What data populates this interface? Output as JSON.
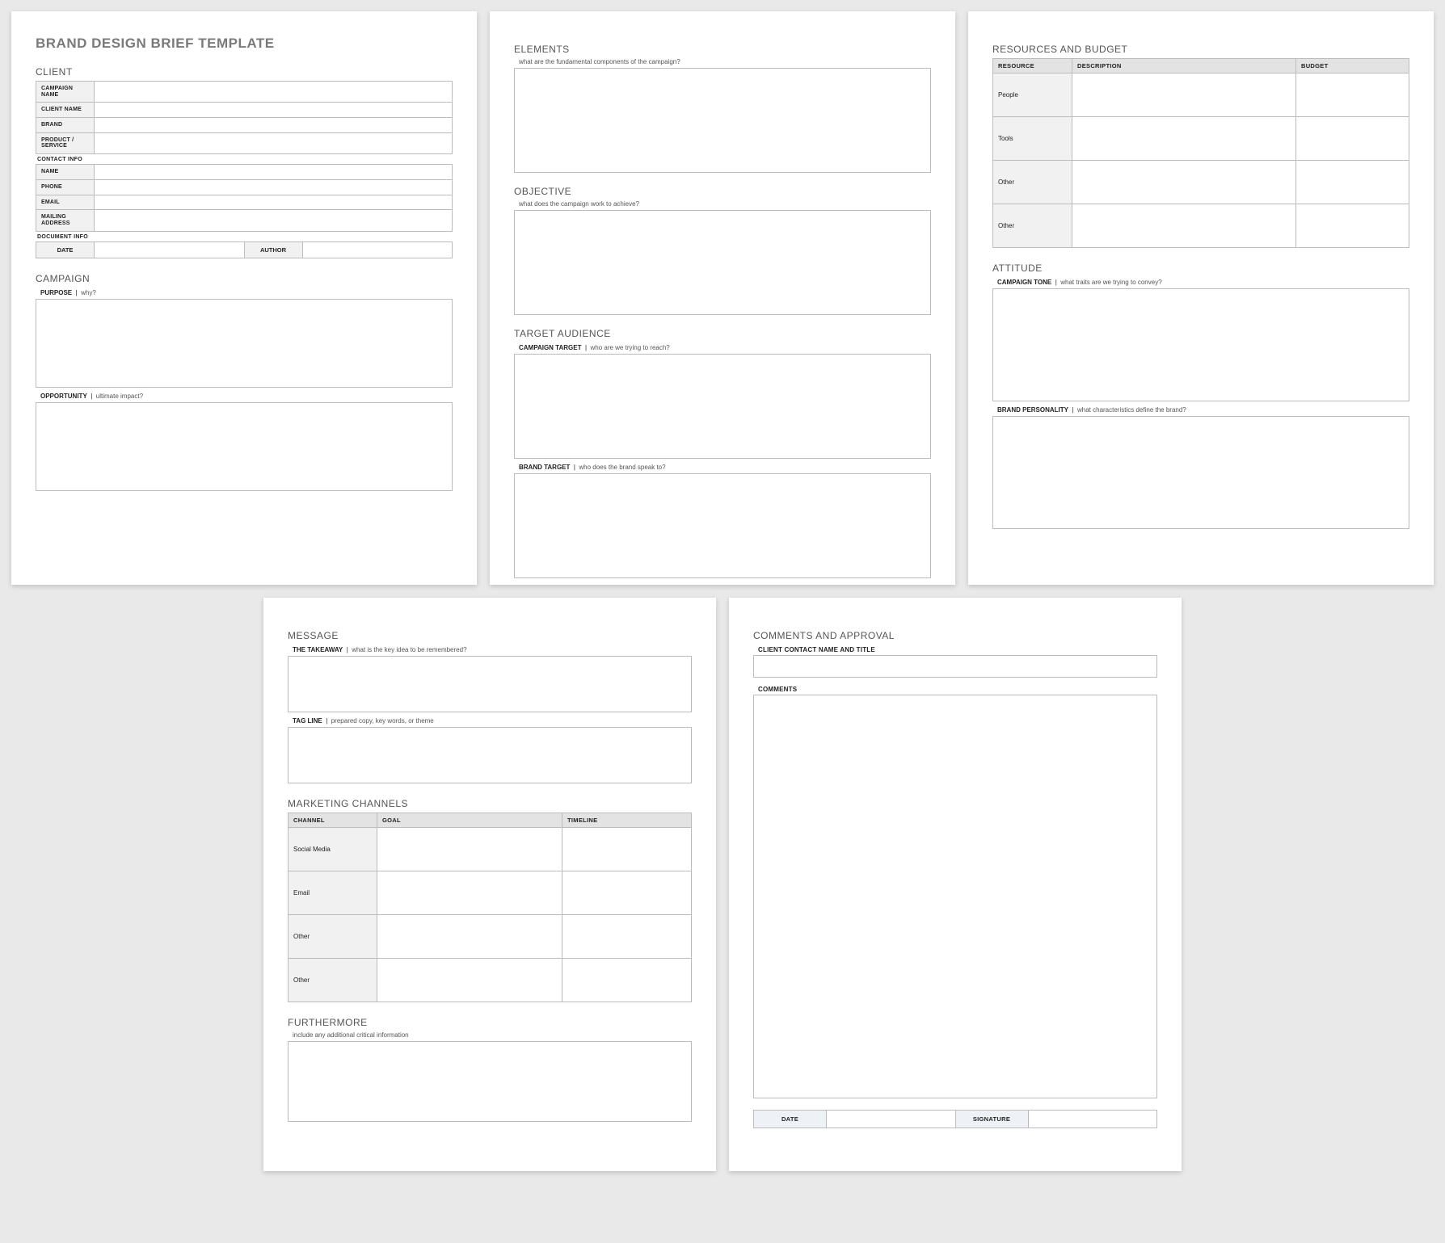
{
  "doc_title": "BRAND DESIGN BRIEF TEMPLATE",
  "page1": {
    "client_head": "CLIENT",
    "client_rows": {
      "campaign_name": "CAMPAIGN NAME",
      "client_name": "CLIENT NAME",
      "brand": "BRAND",
      "product": "PRODUCT / SERVICE"
    },
    "contact_head": "CONTACT INFO",
    "contact_rows": {
      "name": "NAME",
      "phone": "PHONE",
      "email": "EMAIL",
      "address": "MAILING ADDRESS"
    },
    "docinfo_head": "DOCUMENT INFO",
    "docinfo": {
      "date": "DATE",
      "author": "AUTHOR"
    },
    "campaign_head": "CAMPAIGN",
    "purpose": {
      "label": "PURPOSE",
      "hint": "why?"
    },
    "opportunity": {
      "label": "OPPORTUNITY",
      "hint": "ultimate impact?"
    }
  },
  "page2": {
    "elements_head": "ELEMENTS",
    "elements_hint": "what are the fundamental components of the campaign?",
    "objective_head": "OBJECTIVE",
    "objective_hint": "what does the campaign work to achieve?",
    "ta_head": "TARGET AUDIENCE",
    "campaign_target": {
      "label": "CAMPAIGN TARGET",
      "hint": "who are we trying to reach?"
    },
    "brand_target": {
      "label": "BRAND TARGET",
      "hint": "who does the brand speak to?"
    }
  },
  "page3": {
    "rb_head": "RESOURCES AND BUDGET",
    "rb_cols": {
      "resource": "RESOURCE",
      "description": "DESCRIPTION",
      "budget": "BUDGET"
    },
    "rb_rows": [
      "People",
      "Tools",
      "Other",
      "Other"
    ],
    "attitude_head": "ATTITUDE",
    "tone": {
      "label": "CAMPAIGN TONE",
      "hint": "what traits are we trying to convey?"
    },
    "personality": {
      "label": "BRAND PERSONALITY",
      "hint": "what characteristics define the brand?"
    }
  },
  "page4": {
    "message_head": "MESSAGE",
    "takeaway": {
      "label": "THE TAKEAWAY",
      "hint": "what is the key idea to be remembered?"
    },
    "tagline": {
      "label": "TAG LINE",
      "hint": "prepared copy, key words, or theme"
    },
    "mc_head": "MARKETING CHANNELS",
    "mc_cols": {
      "channel": "CHANNEL",
      "goal": "GOAL",
      "timeline": "TIMELINE"
    },
    "mc_rows": [
      "Social Media",
      "Email",
      "Other",
      "Other"
    ],
    "further_head": "FURTHERMORE",
    "further_hint": "include any additional critical information"
  },
  "page5": {
    "ca_head": "COMMENTS AND APPROVAL",
    "contact_label": "CLIENT CONTACT NAME AND TITLE",
    "comments_label": "COMMENTS",
    "date_label": "DATE",
    "sig_label": "SIGNATURE"
  }
}
